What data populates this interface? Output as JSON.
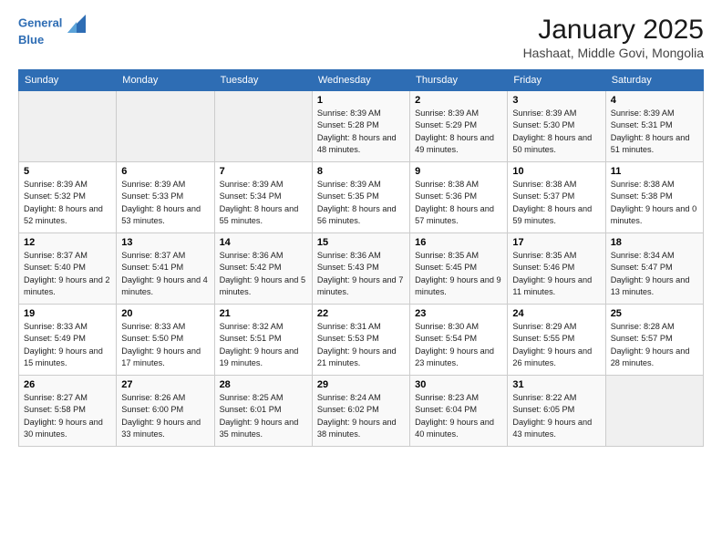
{
  "header": {
    "title": "January 2025",
    "subtitle": "Hashaat, Middle Govi, Mongolia"
  },
  "days": [
    "Sunday",
    "Monday",
    "Tuesday",
    "Wednesday",
    "Thursday",
    "Friday",
    "Saturday"
  ],
  "weeks": [
    [
      {
        "day": "",
        "info": ""
      },
      {
        "day": "",
        "info": ""
      },
      {
        "day": "",
        "info": ""
      },
      {
        "day": "1",
        "info": "Sunrise: 8:39 AM\nSunset: 5:28 PM\nDaylight: 8 hours\nand 48 minutes."
      },
      {
        "day": "2",
        "info": "Sunrise: 8:39 AM\nSunset: 5:29 PM\nDaylight: 8 hours\nand 49 minutes."
      },
      {
        "day": "3",
        "info": "Sunrise: 8:39 AM\nSunset: 5:30 PM\nDaylight: 8 hours\nand 50 minutes."
      },
      {
        "day": "4",
        "info": "Sunrise: 8:39 AM\nSunset: 5:31 PM\nDaylight: 8 hours\nand 51 minutes."
      }
    ],
    [
      {
        "day": "5",
        "info": "Sunrise: 8:39 AM\nSunset: 5:32 PM\nDaylight: 8 hours\nand 52 minutes."
      },
      {
        "day": "6",
        "info": "Sunrise: 8:39 AM\nSunset: 5:33 PM\nDaylight: 8 hours\nand 53 minutes."
      },
      {
        "day": "7",
        "info": "Sunrise: 8:39 AM\nSunset: 5:34 PM\nDaylight: 8 hours\nand 55 minutes."
      },
      {
        "day": "8",
        "info": "Sunrise: 8:39 AM\nSunset: 5:35 PM\nDaylight: 8 hours\nand 56 minutes."
      },
      {
        "day": "9",
        "info": "Sunrise: 8:38 AM\nSunset: 5:36 PM\nDaylight: 8 hours\nand 57 minutes."
      },
      {
        "day": "10",
        "info": "Sunrise: 8:38 AM\nSunset: 5:37 PM\nDaylight: 8 hours\nand 59 minutes."
      },
      {
        "day": "11",
        "info": "Sunrise: 8:38 AM\nSunset: 5:38 PM\nDaylight: 9 hours\nand 0 minutes."
      }
    ],
    [
      {
        "day": "12",
        "info": "Sunrise: 8:37 AM\nSunset: 5:40 PM\nDaylight: 9 hours\nand 2 minutes."
      },
      {
        "day": "13",
        "info": "Sunrise: 8:37 AM\nSunset: 5:41 PM\nDaylight: 9 hours\nand 4 minutes."
      },
      {
        "day": "14",
        "info": "Sunrise: 8:36 AM\nSunset: 5:42 PM\nDaylight: 9 hours\nand 5 minutes."
      },
      {
        "day": "15",
        "info": "Sunrise: 8:36 AM\nSunset: 5:43 PM\nDaylight: 9 hours\nand 7 minutes."
      },
      {
        "day": "16",
        "info": "Sunrise: 8:35 AM\nSunset: 5:45 PM\nDaylight: 9 hours\nand 9 minutes."
      },
      {
        "day": "17",
        "info": "Sunrise: 8:35 AM\nSunset: 5:46 PM\nDaylight: 9 hours\nand 11 minutes."
      },
      {
        "day": "18",
        "info": "Sunrise: 8:34 AM\nSunset: 5:47 PM\nDaylight: 9 hours\nand 13 minutes."
      }
    ],
    [
      {
        "day": "19",
        "info": "Sunrise: 8:33 AM\nSunset: 5:49 PM\nDaylight: 9 hours\nand 15 minutes."
      },
      {
        "day": "20",
        "info": "Sunrise: 8:33 AM\nSunset: 5:50 PM\nDaylight: 9 hours\nand 17 minutes."
      },
      {
        "day": "21",
        "info": "Sunrise: 8:32 AM\nSunset: 5:51 PM\nDaylight: 9 hours\nand 19 minutes."
      },
      {
        "day": "22",
        "info": "Sunrise: 8:31 AM\nSunset: 5:53 PM\nDaylight: 9 hours\nand 21 minutes."
      },
      {
        "day": "23",
        "info": "Sunrise: 8:30 AM\nSunset: 5:54 PM\nDaylight: 9 hours\nand 23 minutes."
      },
      {
        "day": "24",
        "info": "Sunrise: 8:29 AM\nSunset: 5:55 PM\nDaylight: 9 hours\nand 26 minutes."
      },
      {
        "day": "25",
        "info": "Sunrise: 8:28 AM\nSunset: 5:57 PM\nDaylight: 9 hours\nand 28 minutes."
      }
    ],
    [
      {
        "day": "26",
        "info": "Sunrise: 8:27 AM\nSunset: 5:58 PM\nDaylight: 9 hours\nand 30 minutes."
      },
      {
        "day": "27",
        "info": "Sunrise: 8:26 AM\nSunset: 6:00 PM\nDaylight: 9 hours\nand 33 minutes."
      },
      {
        "day": "28",
        "info": "Sunrise: 8:25 AM\nSunset: 6:01 PM\nDaylight: 9 hours\nand 35 minutes."
      },
      {
        "day": "29",
        "info": "Sunrise: 8:24 AM\nSunset: 6:02 PM\nDaylight: 9 hours\nand 38 minutes."
      },
      {
        "day": "30",
        "info": "Sunrise: 8:23 AM\nSunset: 6:04 PM\nDaylight: 9 hours\nand 40 minutes."
      },
      {
        "day": "31",
        "info": "Sunrise: 8:22 AM\nSunset: 6:05 PM\nDaylight: 9 hours\nand 43 minutes."
      },
      {
        "day": "",
        "info": ""
      }
    ]
  ]
}
